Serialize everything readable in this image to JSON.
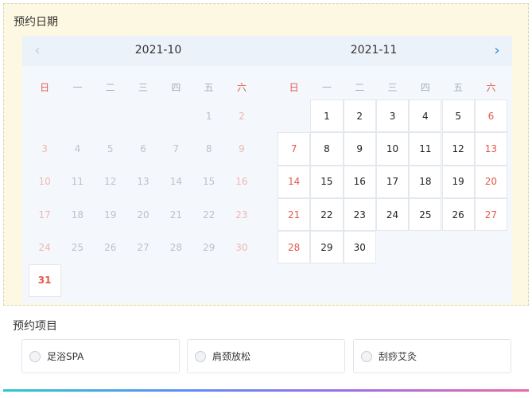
{
  "booking_date": {
    "title": "预约日期",
    "prev_icon": "chevron-left-icon",
    "next_icon": "chevron-right-icon",
    "prev_glyph": "‹",
    "next_glyph": "›",
    "weekdays": [
      "日",
      "一",
      "二",
      "三",
      "四",
      "五",
      "六"
    ],
    "months": [
      {
        "title": "2021-10",
        "first_weekday": 5,
        "days_in_month": 31,
        "selectable_days": [
          31
        ],
        "today": 31
      },
      {
        "title": "2021-11",
        "first_weekday": 1,
        "days_in_month": 30,
        "selectable_days": [
          1,
          2,
          3,
          4,
          5,
          6,
          7,
          8,
          9,
          10,
          11,
          12,
          13,
          14,
          15,
          16,
          17,
          18,
          19,
          20,
          21,
          22,
          23,
          24,
          25,
          26,
          27,
          28,
          29,
          30
        ],
        "today": null
      }
    ]
  },
  "booking_items": {
    "title": "预约项目",
    "options": [
      {
        "label": "足浴SPA",
        "selected": false
      },
      {
        "label": "肩颈放松",
        "selected": false
      },
      {
        "label": "刮痧艾灸",
        "selected": false
      }
    ]
  },
  "colors": {
    "panel_bg": "#fdf8e1",
    "calendar_bg": "#f4f7fc",
    "weekend_red": "#e05a4a",
    "accent_blue": "#2a8ad6"
  }
}
